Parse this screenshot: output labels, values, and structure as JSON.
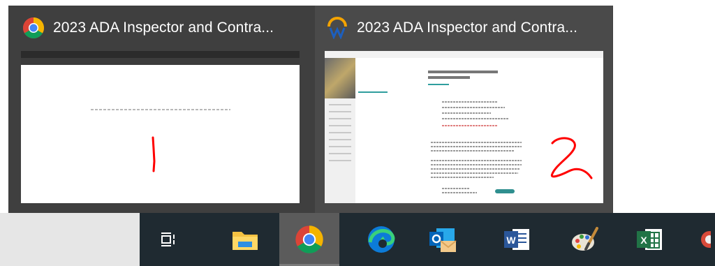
{
  "flyout": {
    "windows": [
      {
        "title": "2023 ADA Inspector and Contra...",
        "icon": "chrome-icon",
        "annotation": "1"
      },
      {
        "title": "2023 ADA Inspector and Contra...",
        "icon": "app-logo-icon",
        "annotation": "2"
      }
    ]
  },
  "taskbar": {
    "items": [
      {
        "name": "task-view-icon"
      },
      {
        "name": "file-explorer-icon"
      },
      {
        "name": "chrome-icon",
        "active": true
      },
      {
        "name": "edge-icon"
      },
      {
        "name": "outlook-icon"
      },
      {
        "name": "word-icon"
      },
      {
        "name": "paint-icon"
      },
      {
        "name": "excel-icon"
      }
    ]
  },
  "colors": {
    "flyout_bg": "#3f3f3f",
    "taskbar_bg": "#1f2a31",
    "annotation_red": "#ff0000"
  }
}
